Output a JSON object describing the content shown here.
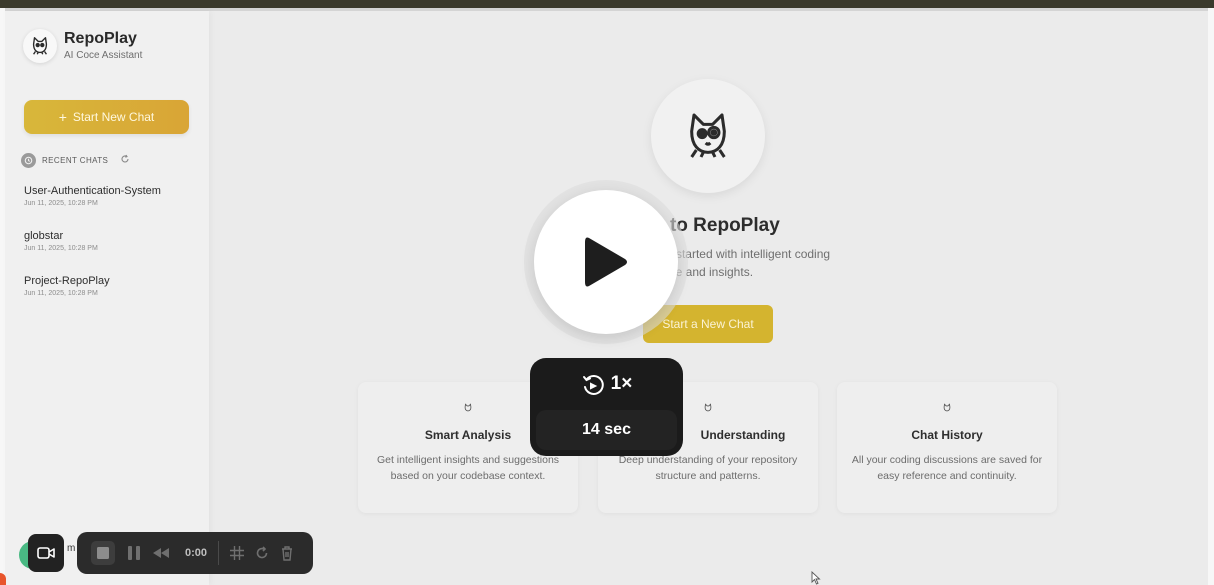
{
  "colors": {
    "accent_gold": "#d4b42f",
    "overlay_dark": "#1b1b1b",
    "recorder_bar": "#2b2b2b",
    "recorder_green": "#49b983"
  },
  "sidebar": {
    "app_title": "RepoPlay",
    "app_subtitle": "AI Coce Assistant",
    "new_chat_label": "Start New Chat",
    "new_chat_icon": "plus-icon",
    "recent_label": "RECENT CHATS",
    "recent_icons": [
      "clock-icon",
      "refresh-icon"
    ],
    "chats": [
      {
        "title": "User-Authentication-System",
        "date": "Jun 11, 2025, 10:28 PM"
      },
      {
        "title": "globstar",
        "date": "Jun 11, 2025, 10:28 PM"
      },
      {
        "title": "Project-RepoPlay",
        "date": "Jun 11, 2025, 10:28 PM"
      }
    ],
    "user_peek": "i m"
  },
  "main": {
    "hero_icon": "cat-mascot-icon",
    "welcome_title": "me to RepoPlay",
    "welcome_desc_line1": "o get started with intelligent coding",
    "welcome_desc_line2": "nce and insights.",
    "start_label": "Start a New Chat",
    "cards": [
      {
        "icon": "cat-icon",
        "title": "Smart Analysis",
        "desc": "Get intelligent insights and suggestions based on your codebase context."
      },
      {
        "icon": "cat-icon",
        "title": "Understanding",
        "desc": "Deep understanding of your repository structure and patterns."
      },
      {
        "icon": "cat-icon",
        "title": "Chat History",
        "desc": "All your coding discussions are saved for easy reference and continuity."
      }
    ]
  },
  "video_overlay": {
    "play_icon": "play-icon",
    "speed_icon": "playback-speed-icon",
    "speed": "1×",
    "duration": "14 sec"
  },
  "recorder": {
    "camera_icon": "camera-icon",
    "timer": "0:00",
    "icons": [
      "stop-icon",
      "pause-icon",
      "rewind-icon",
      "grid-icon",
      "redo-icon",
      "trash-icon"
    ]
  }
}
